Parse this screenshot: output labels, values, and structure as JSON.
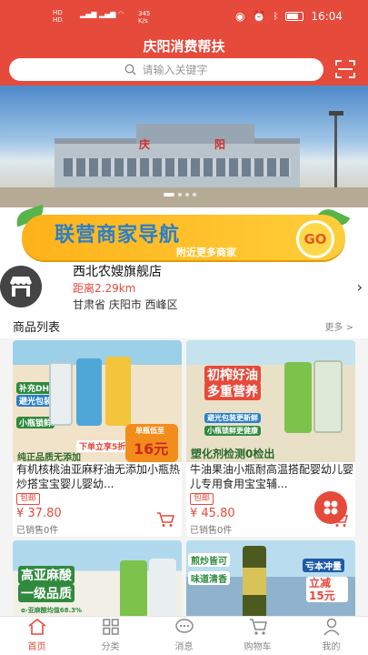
{
  "status": {
    "time": "16:04",
    "speed": "345\nK/s",
    "hd1": "HD",
    "hd2": "HD",
    "net1": "5G",
    "net2": "4G",
    "battery": "88"
  },
  "header": {
    "title": "庆阳消费帮扶",
    "search_placeholder": "请输入关键字"
  },
  "banner": {
    "sign_left": "庆",
    "sign_right": "阳"
  },
  "nav": {
    "title": "联营商家导航",
    "subtitle": "附近更多商家",
    "go": "GO"
  },
  "store": {
    "name": "西北农嫂旗舰店",
    "distance": "距离2.29km",
    "address": "甘肃省 庆阳市 西峰区"
  },
  "product_list": {
    "title": "商品列表",
    "more": "更多 >"
  },
  "products": [
    {
      "name": "有机核桃油亚麻籽油无添加小瓶热炒搭宝宝婴儿婴幼...",
      "tag": "包邮",
      "price": "¥ 37.80",
      "sold": "已销售0件",
      "img_text": [
        "补充DHA",
        "避光包装",
        "小瓶锁鲜",
        "下单立享5折",
        "纯正品质无添加",
        "单瓶低至",
        "16元"
      ]
    },
    {
      "name": "牛油果油小瓶耐高温搭配婴幼儿婴儿专用食用宝宝辅...",
      "tag": "包邮",
      "price": "¥ 45.80",
      "sold": "已销售0件",
      "img_text": [
        "初榨好油",
        "多重营养",
        "避光包装更新鲜",
        "小瓶锁鲜更健康",
        "塑化剂检测0检出"
      ]
    },
    {
      "name": "",
      "tag": "",
      "price": "",
      "sold": "",
      "img_text": [
        "高亚麻酸",
        "一级品质",
        "α-亚麻酸均值68.3%"
      ]
    },
    {
      "name": "",
      "tag": "",
      "price": "",
      "sold": "",
      "img_text": [
        "煎炒皆可",
        "味道清香",
        "亏本冲量",
        "立减15元"
      ]
    }
  ],
  "tabs": [
    {
      "label": "首页",
      "icon": "home-icon"
    },
    {
      "label": "分类",
      "icon": "category-icon"
    },
    {
      "label": "消息",
      "icon": "message-icon"
    },
    {
      "label": "购物车",
      "icon": "cart-icon"
    },
    {
      "label": "我的",
      "icon": "profile-icon"
    }
  ],
  "colors": {
    "brand": "#e64a3b",
    "nav_yellow": "#ffc12a",
    "nav_blue": "#2a7fc9"
  }
}
